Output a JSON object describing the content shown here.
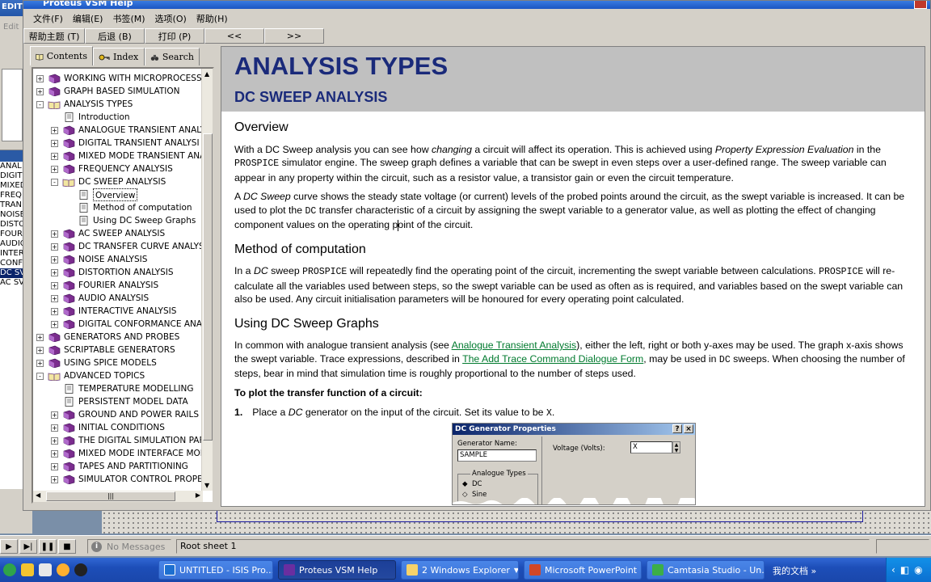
{
  "help_window": {
    "title": "Proteus VSM Help",
    "menu": [
      "文件(F)",
      "编辑(E)",
      "书签(M)",
      "选项(O)",
      "帮助(H)"
    ],
    "toolbar": [
      "帮助主题 (T)",
      "后退 (B)",
      "打印 (P)",
      "<<",
      ">>"
    ]
  },
  "background_isis": {
    "title_fragment": "EDIT - I",
    "menu_fragment": "Edit",
    "device_list": [
      "ANAL",
      "DIGIT",
      "MIXED",
      "FREQ",
      "TRAN",
      "NOISE",
      "DISTO",
      "FOUR",
      "AUDIO",
      "INTER",
      "CONF",
      "DC SV",
      "AC SV"
    ],
    "selected_index": 11
  },
  "nav": {
    "tabs": [
      "Contents",
      "Index",
      "Search"
    ],
    "tree": [
      {
        "level": 0,
        "expander": "+",
        "icon": "book",
        "label": "WORKING WITH MICROPROCESSO"
      },
      {
        "level": 0,
        "expander": "+",
        "icon": "book",
        "label": "GRAPH BASED SIMULATION"
      },
      {
        "level": 0,
        "expander": "-",
        "icon": "openbook",
        "label": "ANALYSIS TYPES"
      },
      {
        "level": 1,
        "expander": "",
        "icon": "page",
        "label": "Introduction"
      },
      {
        "level": 1,
        "expander": "+",
        "icon": "book",
        "label": "ANALOGUE TRANSIENT ANALY"
      },
      {
        "level": 1,
        "expander": "+",
        "icon": "book",
        "label": "DIGITAL TRANSIENT ANALYSI"
      },
      {
        "level": 1,
        "expander": "+",
        "icon": "book",
        "label": "MIXED MODE TRANSIENT ANA"
      },
      {
        "level": 1,
        "expander": "+",
        "icon": "book",
        "label": "FREQUENCY ANALYSIS"
      },
      {
        "level": 1,
        "expander": "-",
        "icon": "openbook",
        "label": "DC SWEEP ANALYSIS"
      },
      {
        "level": 2,
        "expander": "",
        "icon": "page",
        "label": "Overview",
        "selected": true
      },
      {
        "level": 2,
        "expander": "",
        "icon": "page",
        "label": "Method of computation"
      },
      {
        "level": 2,
        "expander": "",
        "icon": "page",
        "label": "Using DC Sweep Graphs"
      },
      {
        "level": 1,
        "expander": "+",
        "icon": "book",
        "label": "AC SWEEP ANALYSIS"
      },
      {
        "level": 1,
        "expander": "+",
        "icon": "book",
        "label": "DC TRANSFER CURVE ANALYS"
      },
      {
        "level": 1,
        "expander": "+",
        "icon": "book",
        "label": "NOISE ANALYSIS"
      },
      {
        "level": 1,
        "expander": "+",
        "icon": "book",
        "label": "DISTORTION ANALYSIS"
      },
      {
        "level": 1,
        "expander": "+",
        "icon": "book",
        "label": "FOURIER ANALYSIS"
      },
      {
        "level": 1,
        "expander": "+",
        "icon": "book",
        "label": "AUDIO ANALYSIS"
      },
      {
        "level": 1,
        "expander": "+",
        "icon": "book",
        "label": "INTERACTIVE ANALYSIS"
      },
      {
        "level": 1,
        "expander": "+",
        "icon": "book",
        "label": "DIGITAL CONFORMANCE ANA"
      },
      {
        "level": 0,
        "expander": "+",
        "icon": "book",
        "label": "GENERATORS AND PROBES"
      },
      {
        "level": 0,
        "expander": "+",
        "icon": "book",
        "label": "SCRIPTABLE GENERATORS"
      },
      {
        "level": 0,
        "expander": "+",
        "icon": "book",
        "label": "USING SPICE MODELS"
      },
      {
        "level": 0,
        "expander": "-",
        "icon": "openbook",
        "label": "ADVANCED TOPICS"
      },
      {
        "level": 1,
        "expander": "",
        "icon": "page",
        "label": "TEMPERATURE MODELLING"
      },
      {
        "level": 1,
        "expander": "",
        "icon": "page",
        "label": "PERSISTENT MODEL DATA"
      },
      {
        "level": 1,
        "expander": "+",
        "icon": "book",
        "label": "GROUND AND POWER RAILS"
      },
      {
        "level": 1,
        "expander": "+",
        "icon": "book",
        "label": "INITIAL CONDITIONS"
      },
      {
        "level": 1,
        "expander": "+",
        "icon": "book",
        "label": "THE DIGITAL SIMULATION PAF"
      },
      {
        "level": 1,
        "expander": "+",
        "icon": "book",
        "label": "MIXED MODE INTERFACE MOD"
      },
      {
        "level": 1,
        "expander": "+",
        "icon": "book",
        "label": "TAPES AND PARTITIONING"
      },
      {
        "level": 1,
        "expander": "+",
        "icon": "book",
        "label": "SIMULATOR CONTROL PROPE"
      }
    ]
  },
  "content": {
    "h1": "ANALYSIS TYPES",
    "h2": "DC SWEEP ANALYSIS",
    "overview_heading": "Overview",
    "overview_p1": {
      "a": "With a DC Sweep analysis you can see how ",
      "b": "changing",
      "c": " a circuit will affect its operation. This is achieved using ",
      "d": "Property Expression Evaluation",
      "e": " in the ",
      "f": "PROSPICE",
      "g": " simulator engine. The sweep graph defines a variable that can be swept in even steps over a user-defined range. The sweep variable can appear in any property within the circuit, such as a resistor value, a transistor gain or even the circuit temperature."
    },
    "overview_p2": {
      "a": "A ",
      "b": "DC Sweep",
      "c": " curve shows the steady state voltage (or current) levels of the probed points around the circuit, as the swept variable is increased. It can be used to plot the ",
      "d": "DC",
      "e": " transfer characteristic of a circuit by assigning the swept variable to a generator value, as well as plotting the effect of changing component values on the operating point of the circuit."
    },
    "method_heading": "Method of computation",
    "method_p": {
      "a": "In a ",
      "b": "DC",
      "c": " sweep ",
      "d": "PROSPICE",
      "e": " will repeatedly find the operating point of the circuit, incrementing the swept variable between calculations. ",
      "f": "PROSPICE",
      "g": " will re-calculate all the variables used between steps, so the swept variable can be used as often as is required, and variables based on the swept variable can also be used. Any circuit initialisation parameters will be honoured for every operating point calculated."
    },
    "using_heading": "Using DC Sweep Graphs",
    "using_p": {
      "a": "In common with analogue transient analysis (see ",
      "link1": "Analogue Transient Analysis",
      "b": "), either the left, right or both y-axes may be used. The graph x-axis shows the swept variable. Trace expressions, described in ",
      "link2": "The Add Trace Command Dialogue Form",
      "c": ", may be used in ",
      "d": "DC",
      "e": " sweeps. When choosing the number of steps, bear in mind that simulation time is roughly proportional to the number of steps used."
    },
    "plot_heading": "To plot the transfer function of a circuit:",
    "step1": {
      "num": "1.",
      "a": "Place a ",
      "b": "DC",
      "c": " generator on the input of the circuit. Set its value to be ",
      "d": "X",
      "e": "."
    },
    "dialog": {
      "title": "DC Generator Properties",
      "help_btn": "?",
      "close_btn": "×",
      "gen_name_label": "Generator Name:",
      "gen_name_value": "SAMPLE",
      "voltage_label": "Voltage (Volts):",
      "voltage_value": "X",
      "group_label": "Analogue Types",
      "radio1": "DC",
      "radio2": "Sine"
    }
  },
  "statusbar": {
    "messages": "No Messages",
    "sheet": "Root sheet 1"
  },
  "taskbar": {
    "tasks": [
      "UNTITLED - ISIS Pro...",
      "Proteus VSM Help",
      "2 Windows Explorer",
      "Microsoft PowerPoint",
      "Camtasia Studio - Un..."
    ],
    "active_index": 1,
    "tray_text": "我的文档",
    "tray_more": "»"
  },
  "colors": {
    "heading_blue": "#1a2a7a",
    "link_green": "#007a2e",
    "taskbar_blue": "#1d4eb8",
    "book_purple": "#7b2d8e"
  }
}
